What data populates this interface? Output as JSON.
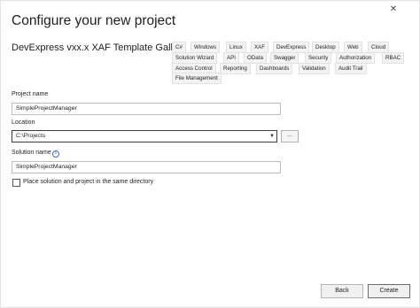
{
  "window": {
    "close_glyph": "✕"
  },
  "header": {
    "title": "Configure your new project",
    "template_name": "DevExpress vxx.x XAF Template Gallery"
  },
  "tags": [
    "C#",
    "Windows",
    "Linux",
    "XAF",
    "DevExpress",
    "Desktop",
    "Web",
    "Cloud",
    "Solution Wizard",
    "API",
    "OData",
    "Swagger",
    "Security",
    "Authorization",
    "RBAC",
    "Access Control",
    "Reporting",
    "Dashboards",
    "Validation",
    "Audit Trail",
    "File Management"
  ],
  "form": {
    "project_name_label": "Project name",
    "project_name_value": "SimpleProjectManager",
    "location_label": "Location",
    "location_value": "C:\\Projects",
    "browse_label": "...",
    "solution_name_label": "Solution name",
    "solution_name_value": "SimpleProjectManager",
    "info_glyph": "i",
    "same_directory_label": "Place solution and project in the same directory",
    "same_directory_checked": false
  },
  "footer": {
    "back_label": "Back",
    "create_label": "Create"
  },
  "icons": {
    "close": "close-icon",
    "info": "info-icon",
    "dropdown": "chevron-down-icon"
  }
}
